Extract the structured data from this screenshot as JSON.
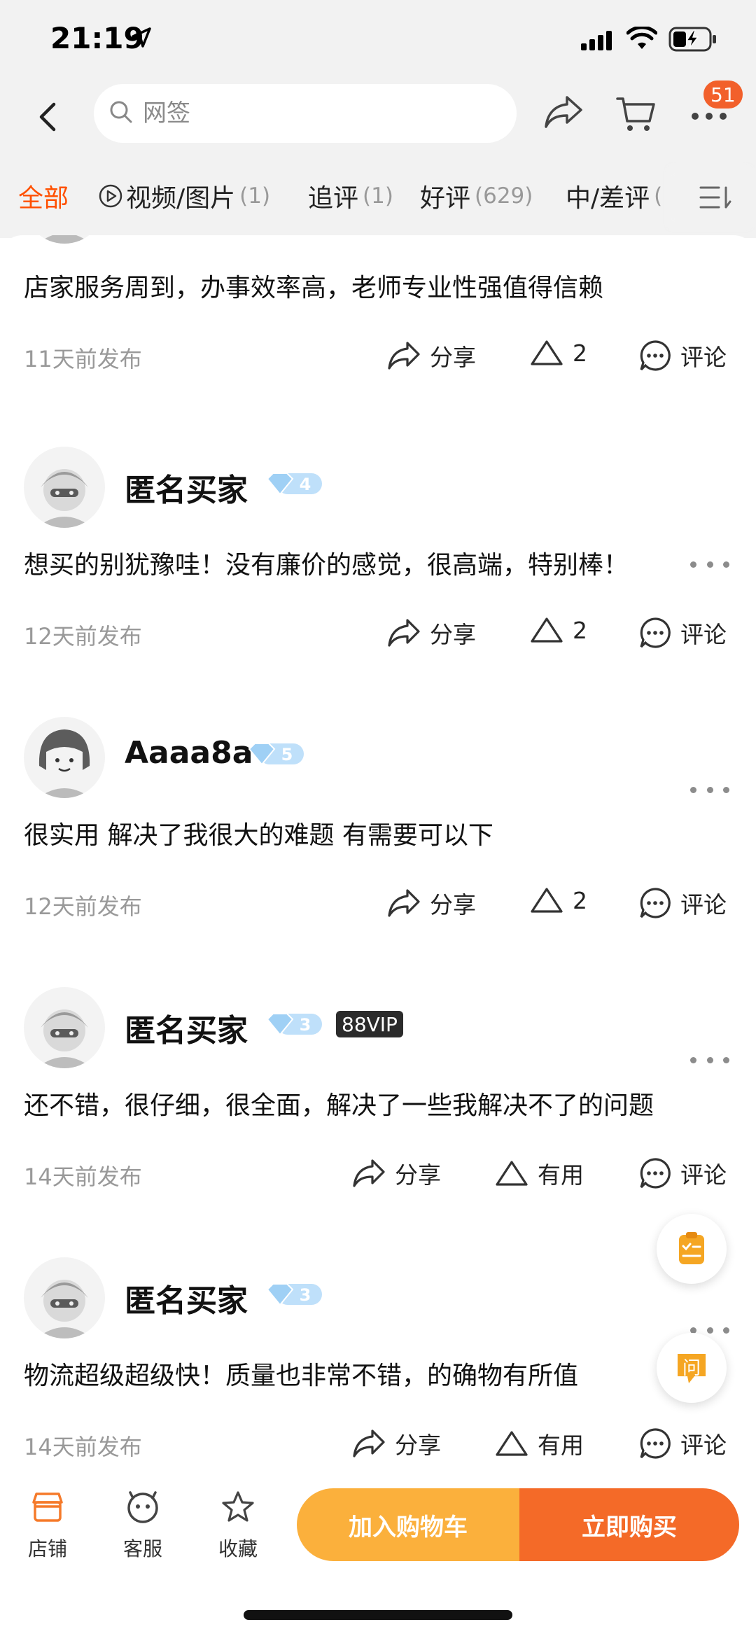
{
  "status_bar": {
    "time": "21:19"
  },
  "nav": {
    "search_placeholder": "网签",
    "badge_count": "51"
  },
  "filters": [
    {
      "label": "全部",
      "count": ""
    },
    {
      "label": "视频/图片",
      "count": "(1)"
    },
    {
      "label": "追评",
      "count": "(1)"
    },
    {
      "label": "好评",
      "count": "(629)"
    },
    {
      "label": "中/差评",
      "count": "("
    }
  ],
  "reviews": [
    {
      "text": "店家服务周到，办事效率高，老师专业性强值得信赖",
      "date": "11天前发布",
      "share": "分享",
      "useful": "2",
      "comment": "评论"
    },
    {
      "name": "匿名买家",
      "level": "4",
      "text": "想买的别犹豫哇！没有廉价的感觉，很高端，特别棒！",
      "date": "12天前发布",
      "share": "分享",
      "useful": "2",
      "comment": "评论"
    },
    {
      "name": "Aaaa8a",
      "level": "5",
      "text": "很实用  解决了我很大的难题  有需要可以下",
      "date": "12天前发布",
      "share": "分享",
      "useful": "2",
      "comment": "评论"
    },
    {
      "name": "匿名买家",
      "level": "3",
      "vip": "88VIP",
      "text": "还不错，很仔细，很全面，解决了一些我解决不了的问题",
      "date": "14天前发布",
      "share": "分享",
      "useful": "有用",
      "comment": "评论"
    },
    {
      "name": "匿名买家",
      "level": "3",
      "text": "物流超级超级快！质量也非常不错，的确物有所值",
      "date": "14天前发布",
      "share": "分享",
      "useful": "有用",
      "comment": "评论"
    }
  ],
  "float_buttons": {
    "ask_label": "问"
  },
  "bottom_bar": {
    "shop": "店铺",
    "service": "客服",
    "favorite": "收藏",
    "add_to_cart": "加入购物车",
    "buy_now": "立即购买"
  },
  "colors": {
    "accent": "#ff5000",
    "cart": "#fbb03c",
    "buy": "#f46a28"
  }
}
